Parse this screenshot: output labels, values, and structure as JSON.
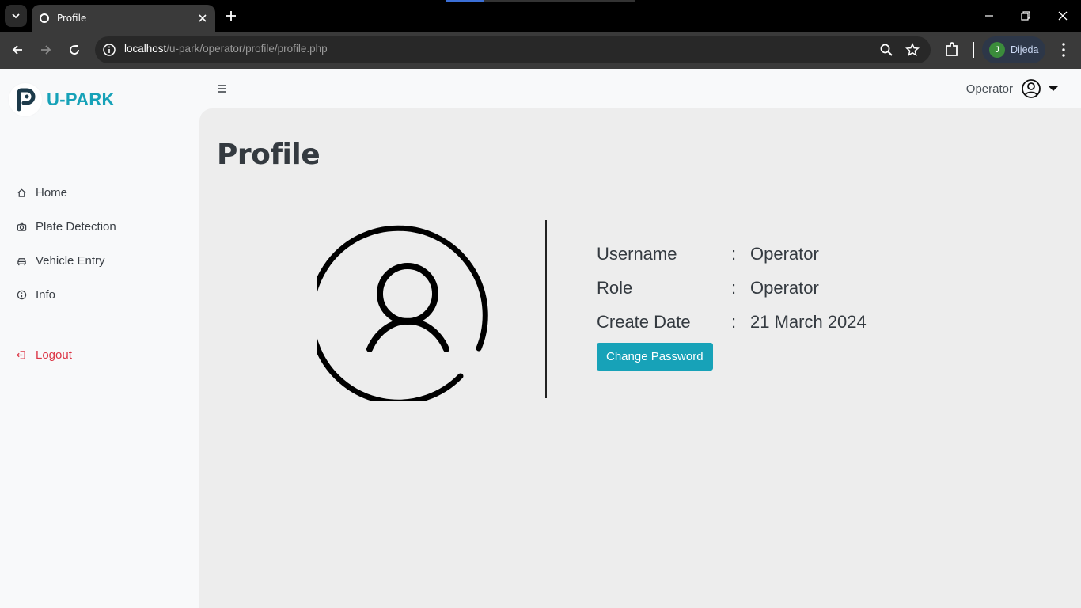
{
  "browser": {
    "tab_title": "Profile",
    "url_host": "localhost",
    "url_path": "/u-park/operator/profile/profile.php",
    "profile_initial": "J",
    "profile_name": "Dijeda"
  },
  "brand": {
    "name": "U-PARK",
    "color": "#17a2b8"
  },
  "sidebar": {
    "items": [
      {
        "label": "Home",
        "icon": "home-icon"
      },
      {
        "label": "Plate Detection",
        "icon": "camera-icon"
      },
      {
        "label": "Vehicle Entry",
        "icon": "car-icon"
      },
      {
        "label": "Info",
        "icon": "info-icon"
      }
    ],
    "logout_label": "Logout",
    "logout_color": "#dc3545"
  },
  "header": {
    "user_label": "Operator"
  },
  "main": {
    "title": "Profile",
    "fields": [
      {
        "label": "Username",
        "separator": ":",
        "value": "Operator"
      },
      {
        "label": "Role",
        "separator": ":",
        "value": "Operator"
      },
      {
        "label": "Create Date",
        "separator": ":",
        "value": "21 March 2024"
      }
    ],
    "change_password_label": "Change Password"
  }
}
